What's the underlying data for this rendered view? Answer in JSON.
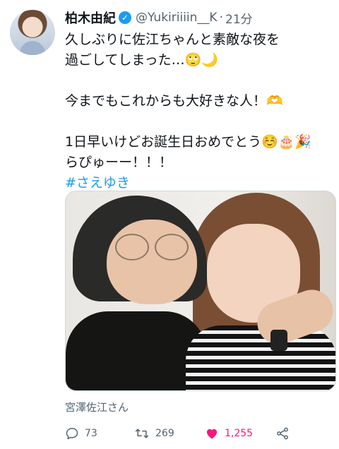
{
  "author": {
    "display_name": "柏木由紀",
    "handle": "@Yukiriiiin__K",
    "separator": "·",
    "time": "21分",
    "verified_icon": "✓"
  },
  "tweet": {
    "lines": [
      "久しぶりに佐江ちゃんと素敵な夜を",
      "過ごしてしまった…🙄🌙",
      "",
      "今までもこれからも大好きな人！🫶",
      "",
      "1日早いけどお誕生日おめでとう☺️🎂🎉",
      "らぴゅーー！！！"
    ],
    "hashtag": "#さえゆき"
  },
  "media": {
    "tagged_user": "宮澤佐江さん"
  },
  "actions": {
    "reply_count": "73",
    "retweet_count": "269",
    "like_count": "1,255"
  },
  "colors": {
    "accent": "#1d9bf0",
    "like": "#f91880",
    "muted": "#536471"
  },
  "icons": [
    "verified-badge-icon",
    "reply-icon",
    "retweet-icon",
    "heart-icon",
    "share-icon"
  ]
}
